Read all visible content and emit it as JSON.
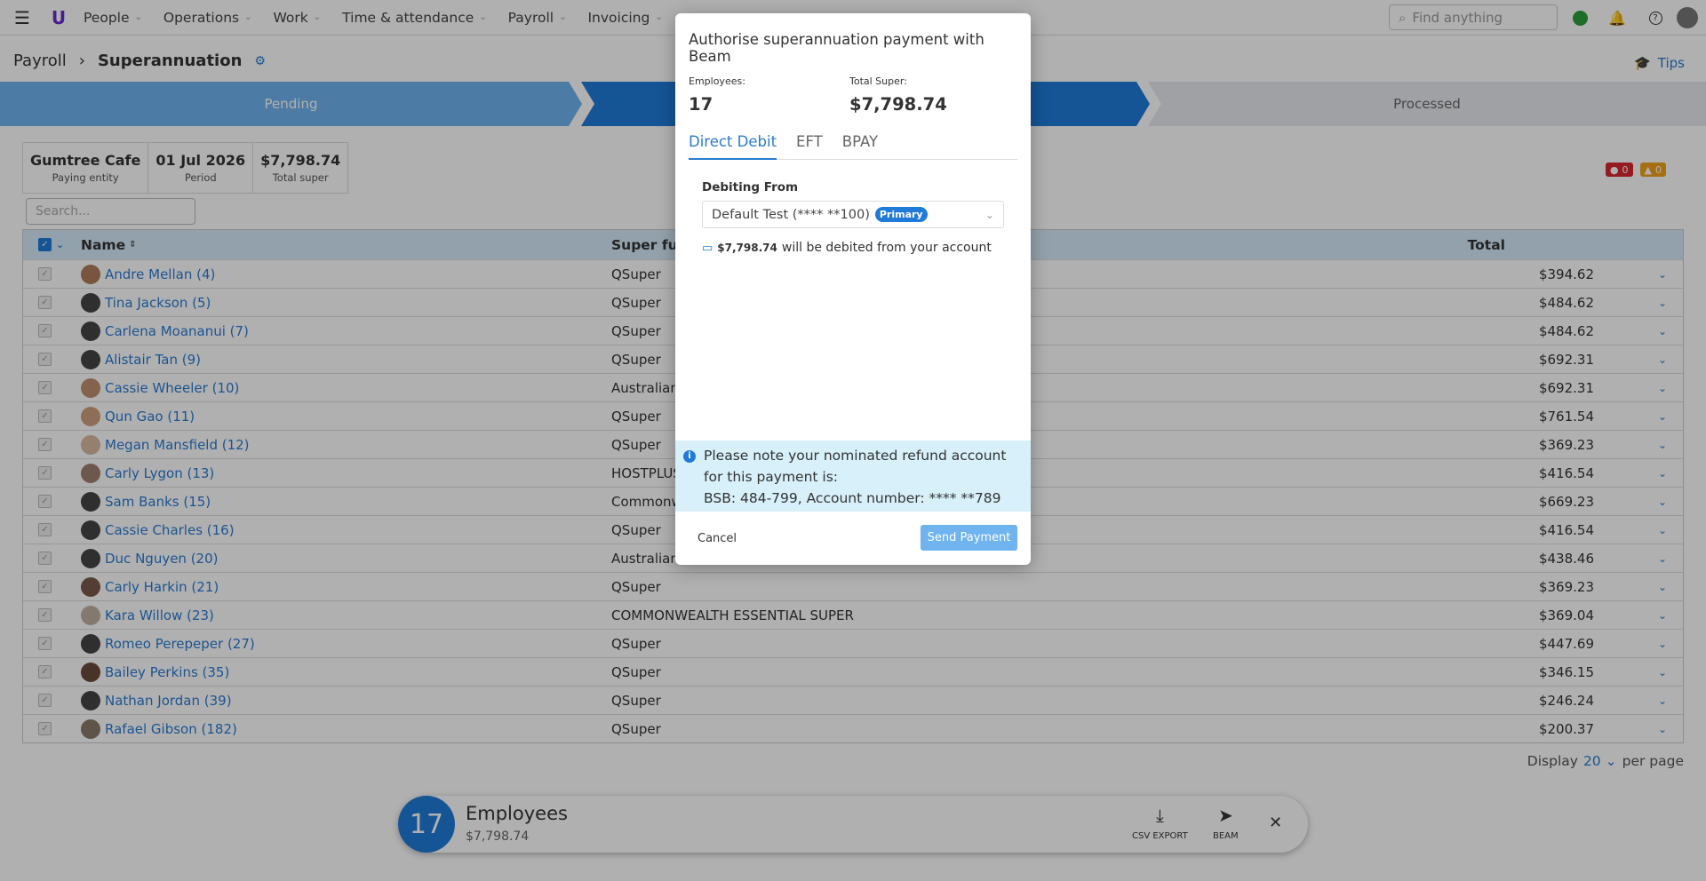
{
  "nav": {
    "items": [
      "People",
      "Operations",
      "Work",
      "Time & attendance",
      "Payroll",
      "Invoicing"
    ],
    "search_placeholder": "Find anything"
  },
  "breadcrumb": {
    "parent": "Payroll",
    "current": "Superannuation"
  },
  "tips": "Tips",
  "steps": {
    "step1": "Pending",
    "step3": "Processed"
  },
  "summary": [
    {
      "value": "Gumtree Cafe",
      "label": "Paying entity"
    },
    {
      "value": "01 Jul 2026",
      "label": "Period"
    },
    {
      "value": "$7,798.74",
      "label": "Total super"
    }
  ],
  "badges": {
    "errors": "0",
    "warnings": "0"
  },
  "list_search_placeholder": "Search...",
  "table": {
    "headers": {
      "name": "Name",
      "fund": "Super fund",
      "total": "Total"
    },
    "rows": [
      {
        "name": "Andre Mellan (4)",
        "fund": "QSuper",
        "total": "$394.62"
      },
      {
        "name": "Tina Jackson (5)",
        "fund": "QSuper",
        "total": "$484.62"
      },
      {
        "name": "Carlena Moananui (7)",
        "fund": "QSuper",
        "total": "$484.62"
      },
      {
        "name": "Alistair Tan (9)",
        "fund": "QSuper",
        "total": "$692.31"
      },
      {
        "name": "Cassie Wheeler (10)",
        "fund": "Australian",
        "total": "$692.31"
      },
      {
        "name": "Qun Gao (11)",
        "fund": "QSuper",
        "total": "$761.54"
      },
      {
        "name": "Megan Mansfield (12)",
        "fund": "QSuper",
        "total": "$369.23"
      },
      {
        "name": "Carly Lygon (13)",
        "fund": "HOSTPLUS",
        "total": "$416.54"
      },
      {
        "name": "Sam Banks (15)",
        "fund": "Commonw",
        "total": "$669.23"
      },
      {
        "name": "Cassie Charles (16)",
        "fund": "QSuper",
        "total": "$416.54"
      },
      {
        "name": "Duc Nguyen (20)",
        "fund": "Australian",
        "total": "$438.46"
      },
      {
        "name": "Carly Harkin (21)",
        "fund": "QSuper",
        "total": "$369.23"
      },
      {
        "name": "Kara Willow (23)",
        "fund": "COMMONWEALTH ESSENTIAL SUPER",
        "total": "$369.04"
      },
      {
        "name": "Romeo Perepeper (27)",
        "fund": "QSuper",
        "total": "$447.69"
      },
      {
        "name": "Bailey Perkins (35)",
        "fund": "QSuper",
        "total": "$346.15"
      },
      {
        "name": "Nathan Jordan (39)",
        "fund": "QSuper",
        "total": "$246.24"
      },
      {
        "name": "Rafael Gibson (182)",
        "fund": "QSuper",
        "total": "$200.37"
      }
    ]
  },
  "pagination": {
    "display": "Display",
    "per_page_value": "20",
    "per_page": "per page"
  },
  "bottom_bar": {
    "count": "17",
    "label": "Employees",
    "total": "$7,798.74",
    "csv": "CSV EXPORT",
    "beam": "BEAM"
  },
  "modal": {
    "title": "Authorise superannuation payment with Beam",
    "employees_label": "Employees:",
    "employees_value": "17",
    "total_label": "Total Super:",
    "total_value": "$7,798.74",
    "tabs": [
      "Direct Debit",
      "EFT",
      "BPAY"
    ],
    "debiting_label": "Debiting From",
    "account": "Default Test (**** **100)",
    "primary": "Primary",
    "debit_amount": "$7,798.74",
    "debit_text": "will be debited from your account",
    "note_line1": "Please note your nominated refund account for this payment is:",
    "note_line2": "BSB: 484-799, Account number: **** **789",
    "cancel": "Cancel",
    "send": "Send Payment"
  },
  "colors": {
    "accent": "#1f7ad8",
    "link": "#2a7bd1",
    "header_row": "#d6e9fa",
    "note_bg": "#d7f0fa"
  }
}
